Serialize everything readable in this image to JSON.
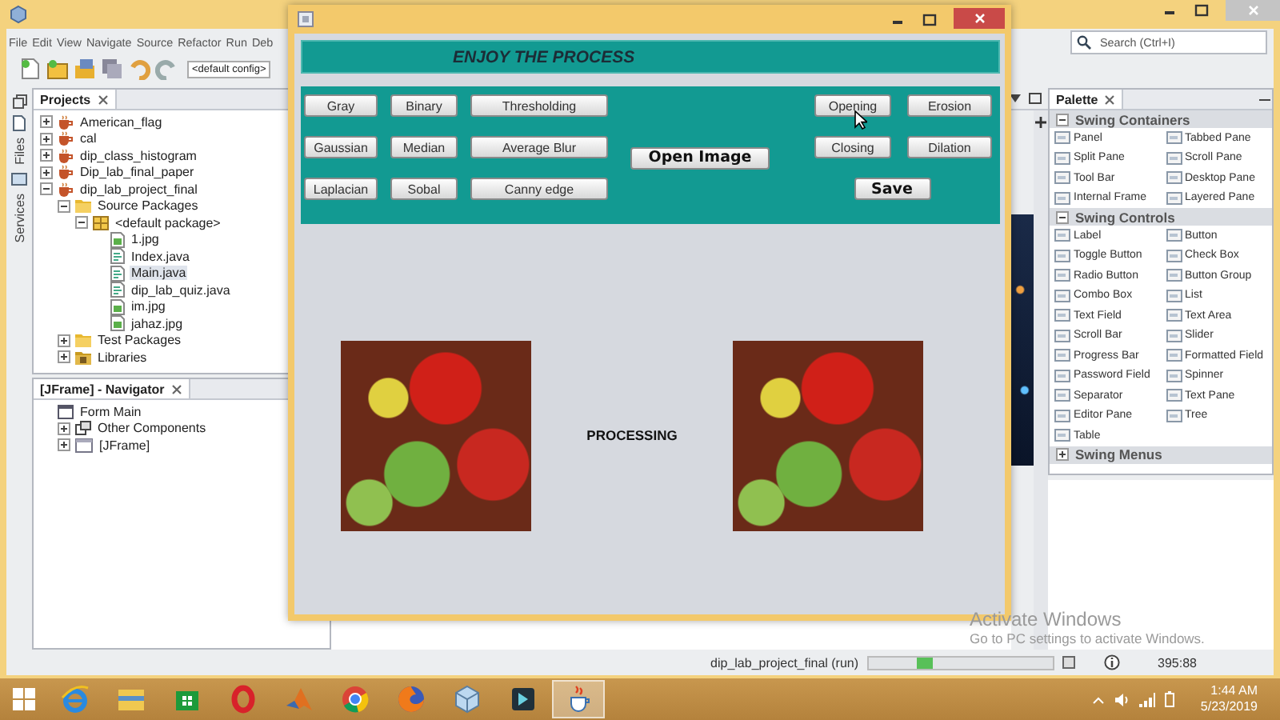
{
  "ide": {
    "menu": [
      "File",
      "Edit",
      "View",
      "Navigate",
      "Source",
      "Refactor",
      "Run",
      "Deb"
    ],
    "config": "<default config>",
    "search": {
      "placeholder": "Search (Ctrl+I)"
    },
    "side_tabs": [
      "Files",
      "Services"
    ],
    "projects": {
      "title": "Projects",
      "tree": [
        {
          "label": "American_flag",
          "kind": "project",
          "expanded": false,
          "selected": false
        },
        {
          "label": "cal",
          "kind": "project",
          "expanded": false,
          "selected": false
        },
        {
          "label": "dip_class_histogram",
          "kind": "project",
          "expanded": false,
          "selected": false
        },
        {
          "label": "Dip_lab_final_paper",
          "kind": "project",
          "expanded": false,
          "selected": false
        },
        {
          "label": "dip_lab_project_final",
          "kind": "project",
          "expanded": true,
          "selected": false,
          "children": [
            {
              "label": "Source Packages",
              "kind": "folder",
              "expanded": true,
              "selected": false,
              "children": [
                {
                  "label": "<default package>",
                  "kind": "package",
                  "expanded": true,
                  "selected": false,
                  "children": [
                    {
                      "label": "1.jpg",
                      "kind": "image",
                      "selected": false
                    },
                    {
                      "label": "Index.java",
                      "kind": "java",
                      "selected": false
                    },
                    {
                      "label": "Main.java",
                      "kind": "java",
                      "selected": true
                    },
                    {
                      "label": "dip_lab_quiz.java",
                      "kind": "java",
                      "selected": false
                    },
                    {
                      "label": "im.jpg",
                      "kind": "image",
                      "selected": false
                    },
                    {
                      "label": "jahaz.jpg",
                      "kind": "image",
                      "selected": false
                    }
                  ]
                }
              ]
            },
            {
              "label": "Test Packages",
              "kind": "folder",
              "expanded": false,
              "selected": false
            },
            {
              "label": "Libraries",
              "kind": "library",
              "expanded": false,
              "selected": false
            }
          ]
        }
      ]
    },
    "navigator": {
      "title": "[JFrame] - Navigator",
      "tree": [
        {
          "label": "Form Main",
          "kind": "form",
          "selected": false,
          "children": [
            {
              "label": "Other Components",
              "kind": "components",
              "expanded": false,
              "selected": false
            },
            {
              "label": "[JFrame]",
              "kind": "frame",
              "expanded": false,
              "selected": false
            }
          ]
        }
      ]
    },
    "palette": {
      "title": "Palette",
      "sections": [
        {
          "title": "Swing Containers",
          "expanded": true,
          "items": [
            "Panel",
            "Tabbed Pane",
            "Split Pane",
            "Scroll Pane",
            "Tool Bar",
            "Desktop Pane",
            "Internal Frame",
            "Layered Pane"
          ]
        },
        {
          "title": "Swing Controls",
          "expanded": true,
          "items": [
            "Label",
            "Button",
            "Toggle Button",
            "Check Box",
            "Radio Button",
            "Button Group",
            "Combo Box",
            "List",
            "Text Field",
            "Text Area",
            "Scroll Bar",
            "Slider",
            "Progress Bar",
            "Formatted Field",
            "Password Field",
            "Spinner",
            "Separator",
            "Text Pane",
            "Editor Pane",
            "Tree",
            "Table"
          ]
        },
        {
          "title": "Swing Menus",
          "expanded": false
        }
      ]
    },
    "status_bar": {
      "task": "dip_lab_project_final (run)",
      "progress": {
        "level": 0.35
      },
      "position": "395:88"
    }
  },
  "app_window": {
    "header": "ENJOY THE PROCESS",
    "filter_buttons": [
      [
        "Gray",
        "Binary",
        "Thresholding"
      ],
      [
        "Gaussian",
        "Median",
        "Average Blur"
      ],
      [
        "Laplacian",
        "Sobal",
        "Canny edge"
      ]
    ],
    "open_button": "Open Image",
    "morphology_buttons": [
      [
        "Opening",
        "Erosion"
      ],
      [
        "Closing",
        "Dilation"
      ]
    ],
    "save_button": "Save",
    "status": "PROCESSING"
  },
  "overlay": {
    "title": "Activate Windows",
    "text": "Go to PC settings to activate Windows."
  },
  "taskbar": {
    "apps": [
      {
        "kind": "ie",
        "selected": false
      },
      {
        "kind": "explorer",
        "selected": false
      },
      {
        "kind": "store",
        "selected": false
      },
      {
        "kind": "opera",
        "selected": false
      },
      {
        "kind": "matlab",
        "selected": false
      },
      {
        "kind": "chrome",
        "selected": false
      },
      {
        "kind": "firefox",
        "selected": false
      },
      {
        "kind": "cube",
        "selected": false
      },
      {
        "kind": "media",
        "selected": false
      },
      {
        "kind": "java",
        "selected": true
      }
    ],
    "time": "1:44 AM",
    "date": "5/23/2019"
  }
}
